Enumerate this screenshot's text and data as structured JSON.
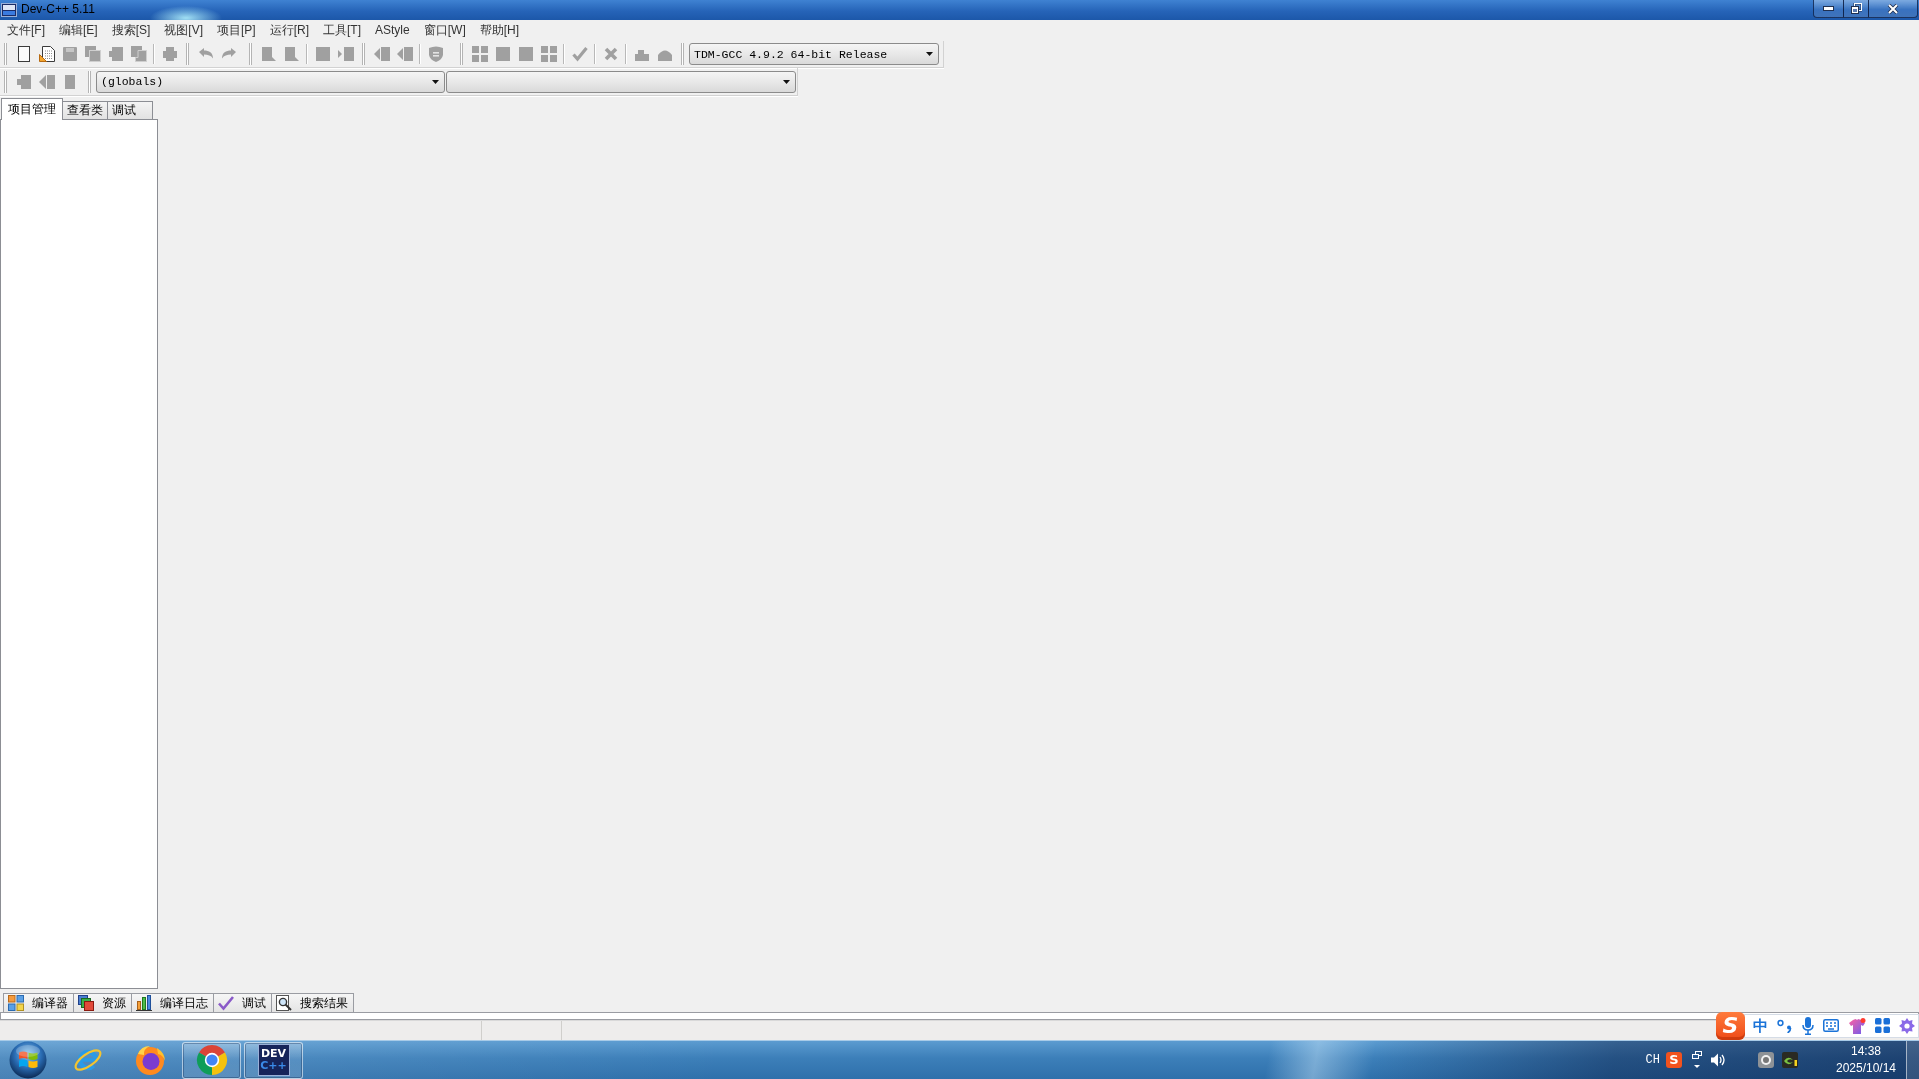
{
  "window": {
    "title": "Dev-C++ 5.11"
  },
  "menu_bar": [
    "文件[F]",
    "编辑[E]",
    "搜索[S]",
    "视图[V]",
    "项目[P]",
    "运行[R]",
    "工具[T]",
    "AStyle",
    "窗口[W]",
    "帮助[H]"
  ],
  "main_toolbar": {
    "groups": [
      {
        "buttons": [
          {
            "kind": "new",
            "disabled": false
          },
          {
            "kind": "open",
            "disabled": false
          },
          {
            "kind": "save",
            "disabled": true
          },
          {
            "kind": "save-all",
            "disabled": true
          },
          {
            "kind": "close",
            "disabled": true
          },
          {
            "kind": "close-all",
            "disabled": true
          },
          {
            "kind": "separator"
          },
          {
            "kind": "print",
            "disabled": true
          }
        ]
      },
      {
        "buttons": [
          {
            "kind": "undo",
            "disabled": true
          },
          {
            "kind": "redo",
            "disabled": true
          }
        ]
      },
      {
        "buttons": [
          {
            "kind": "find",
            "disabled": true
          },
          {
            "kind": "replace",
            "disabled": true
          },
          {
            "kind": "separator"
          },
          {
            "kind": "goto",
            "disabled": true
          },
          {
            "kind": "goto-line",
            "disabled": true
          }
        ]
      },
      {
        "buttons": [
          {
            "kind": "indent",
            "disabled": true
          },
          {
            "kind": "unindent",
            "disabled": true
          },
          {
            "kind": "separator"
          },
          {
            "kind": "comment",
            "disabled": true
          }
        ]
      },
      {
        "buttons": [
          {
            "kind": "compile",
            "disabled": true
          },
          {
            "kind": "run",
            "disabled": true
          },
          {
            "kind": "compile-run",
            "disabled": true
          },
          {
            "kind": "rebuild",
            "disabled": true
          },
          {
            "kind": "separator"
          },
          {
            "kind": "check",
            "disabled": true
          },
          {
            "kind": "separator"
          },
          {
            "kind": "stop",
            "disabled": true
          },
          {
            "kind": "separator"
          },
          {
            "kind": "debug",
            "disabled": true
          },
          {
            "kind": "profile",
            "disabled": true
          }
        ]
      }
    ],
    "compiler": "TDM-GCC 4.9.2 64-bit Release"
  },
  "class_toolbar": {
    "buttons": [
      {
        "kind": "insert",
        "disabled": true
      },
      {
        "kind": "back",
        "disabled": true
      },
      {
        "kind": "bookmark",
        "disabled": true
      }
    ],
    "scope": "(globals)"
  },
  "project_panel": {
    "tabs": [
      {
        "label": "项目管理",
        "selected": true
      },
      {
        "label": "查看类",
        "selected": false
      },
      {
        "label": "调试",
        "selected": false
      }
    ]
  },
  "bottom_panel": {
    "tabs": [
      {
        "kind": "compiler",
        "label": "编译器",
        "selected": false
      },
      {
        "kind": "resources",
        "label": "资源",
        "selected": false
      },
      {
        "kind": "log",
        "label": "编译日志",
        "selected": false
      },
      {
        "kind": "debug",
        "label": "调试",
        "selected": false
      },
      {
        "kind": "search",
        "label": "搜索结果",
        "selected": false
      }
    ]
  },
  "ime_bar": {
    "logo": "S",
    "mode": "中"
  },
  "taskbar": {
    "apps": [
      {
        "kind": "explorer",
        "running": false
      },
      {
        "kind": "firefox",
        "running": false
      },
      {
        "kind": "chrome",
        "running": true
      },
      {
        "kind": "devcpp",
        "running": true,
        "logo": [
          "DEV",
          "C++"
        ]
      }
    ],
    "tray": {
      "language": "CH",
      "ime_logo": "S",
      "time": "14:38",
      "date": "2025/10/14"
    }
  }
}
